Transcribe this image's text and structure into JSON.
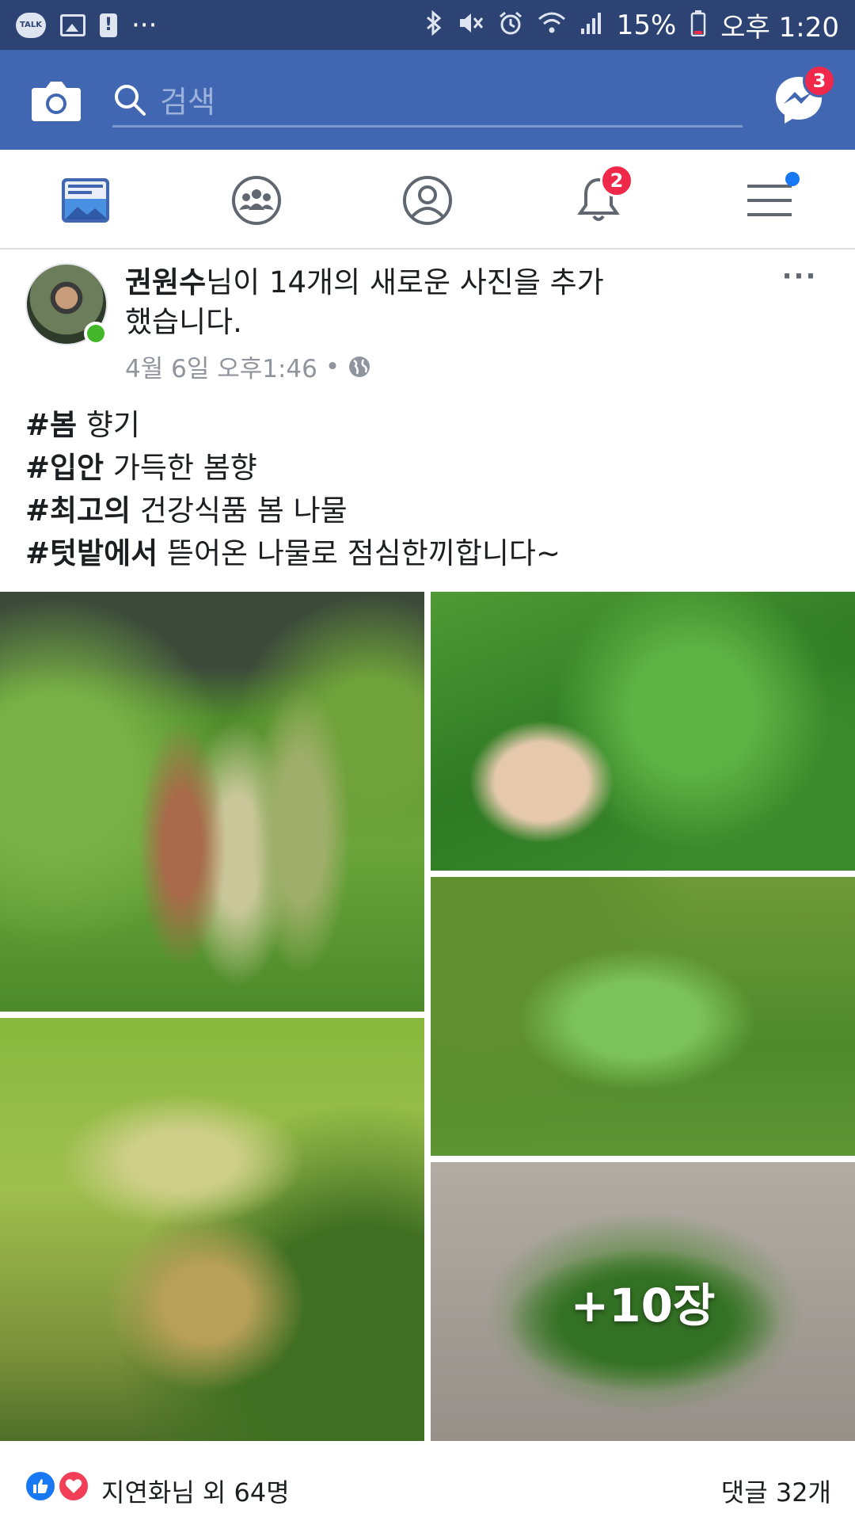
{
  "status_bar": {
    "battery": "15%",
    "time": "오후 1:20",
    "more": "···",
    "talk": "TALK"
  },
  "header": {
    "search_placeholder": "검색",
    "messenger_badge": "3"
  },
  "tabs": {
    "notifications_badge": "2"
  },
  "post": {
    "author": "권원수",
    "title_rest": "님이 14개의 새로운 사진을 추가했습니다.",
    "timestamp": "4월 6일 오후1:46",
    "separator": "•",
    "menu": "···",
    "lines": [
      {
        "tag": "#봄",
        "text": " 향기"
      },
      {
        "tag": "#입안",
        "text": " 가득한 봄향"
      },
      {
        "tag": "#최고의",
        "text": " 건강식품 봄 나물"
      },
      {
        "tag": "#텃밭에서",
        "text": " 뜯어온 나물로 점심한끼합니다~"
      }
    ],
    "more_photos": "+10장",
    "reactions_text": "지연화님 외 64명",
    "comments_text": "댓글 32개"
  },
  "colors": {
    "brand": "#4267b2",
    "status_bar": "#2d4373",
    "badge": "#f02849",
    "online": "#42b72a",
    "like": "#1877f2",
    "love": "#f33e58"
  }
}
